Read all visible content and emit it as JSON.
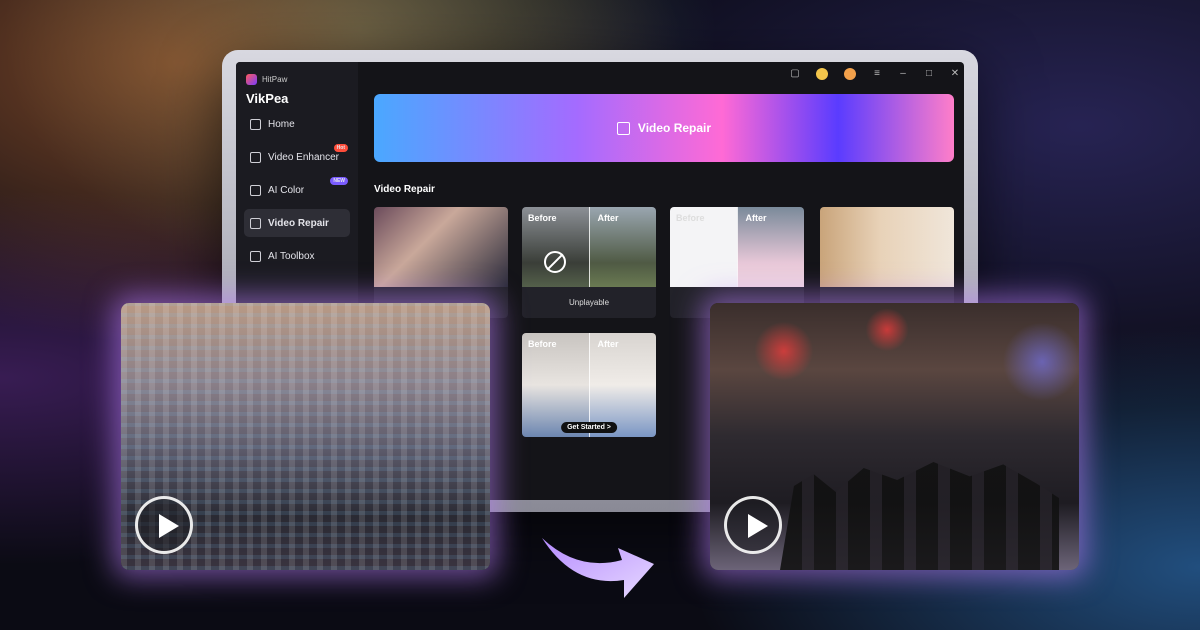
{
  "app": {
    "brand_small": "HitPaw",
    "brand_name": "VikPea"
  },
  "sidebar": {
    "items": [
      {
        "label": "Home",
        "badge": ""
      },
      {
        "label": "Video Enhancer",
        "badge": "Hot"
      },
      {
        "label": "AI Color",
        "badge": "NEW"
      },
      {
        "label": "Video Repair",
        "badge": "",
        "active": true
      },
      {
        "label": "AI Toolbox",
        "badge": ""
      }
    ]
  },
  "hero": {
    "label": "Video Repair"
  },
  "section": {
    "title": "Video Repair"
  },
  "cards": {
    "c2": {
      "before": "Before",
      "after": "After",
      "caption": "Unplayable"
    },
    "c3": {
      "before": "Before",
      "after": "After"
    },
    "c5": {
      "before": "Before",
      "after": "After",
      "cta": "Get Started >"
    }
  },
  "colors": {
    "accent_purple": "#a46bff",
    "accent_pink": "#ff6ad5",
    "accent_blue": "#4aa8ff",
    "hot_badge": "#ff4d3a",
    "new_badge": "#7a5cff"
  }
}
